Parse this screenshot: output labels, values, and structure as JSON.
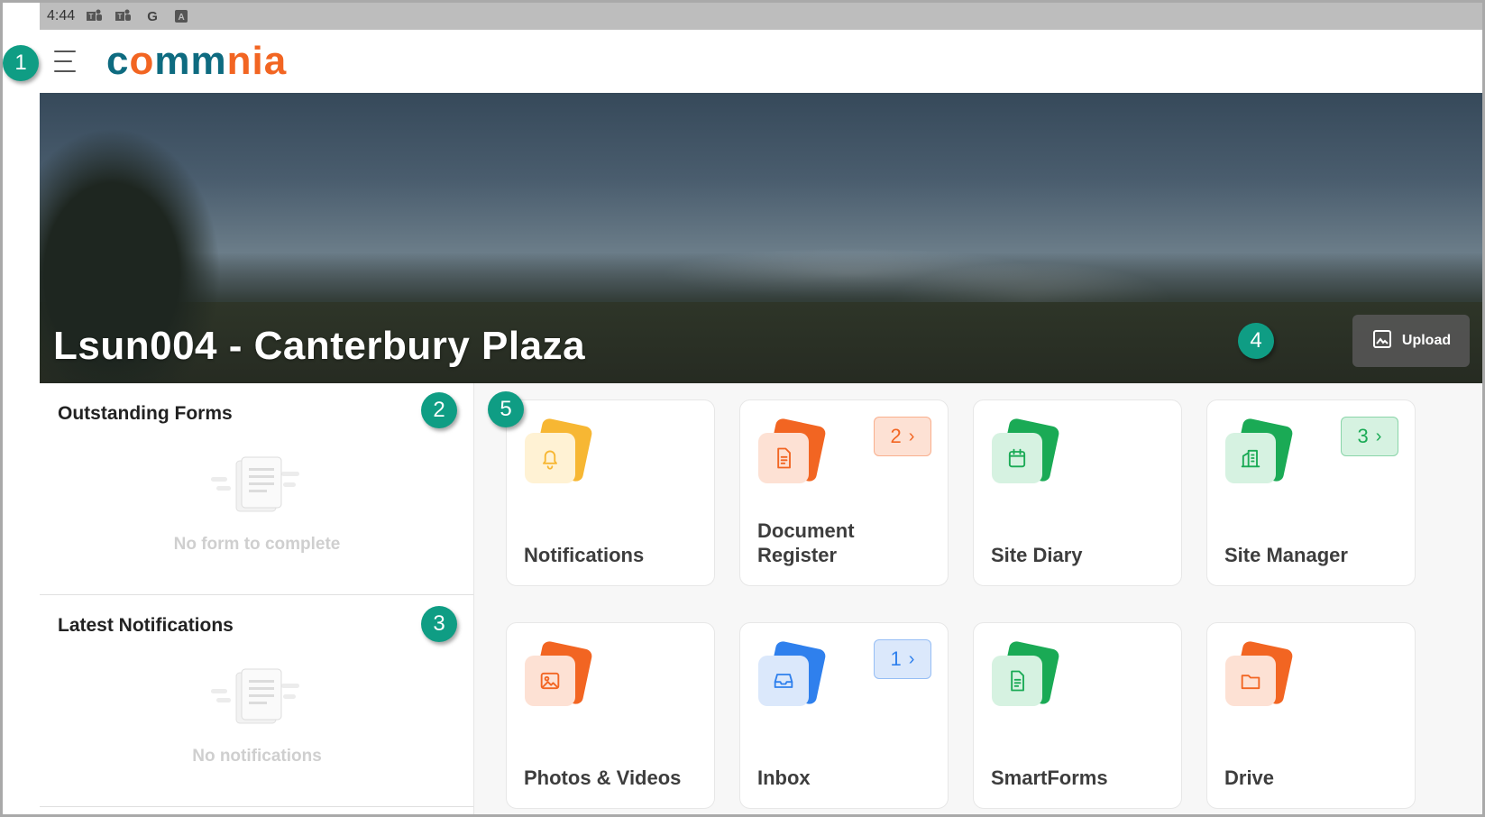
{
  "status_bar": {
    "time": "4:44",
    "icons": [
      "teams-icon",
      "teams-icon",
      "google-icon",
      "a-box-icon"
    ]
  },
  "app": {
    "logo_text": "commnia",
    "menu_icon": "hamburger-icon"
  },
  "callouts": [
    "1",
    "2",
    "3",
    "4",
    "5"
  ],
  "hero": {
    "title": "Lsun004 - Canterbury Plaza",
    "upload_label": "Upload"
  },
  "left_panel": {
    "outstanding_forms": {
      "title": "Outstanding Forms",
      "empty_text": "No form to complete"
    },
    "latest_notifications": {
      "title": "Latest Notifications",
      "empty_text": "No notifications"
    }
  },
  "tiles": [
    {
      "label": "Notifications",
      "icon": "bell-icon",
      "color": "#f7b733",
      "badge": null
    },
    {
      "label": "Document Register",
      "icon": "document-icon",
      "color": "#f26522",
      "badge": "2"
    },
    {
      "label": "Site Diary",
      "icon": "calendar-icon",
      "color": "#1aaa55",
      "badge": null
    },
    {
      "label": "Site Manager",
      "icon": "building-icon",
      "color": "#1aaa55",
      "badge": "3"
    },
    {
      "label": "Photos & Videos",
      "icon": "image-icon",
      "color": "#f26522",
      "badge": null
    },
    {
      "label": "Inbox",
      "icon": "inbox-icon",
      "color": "#2f80ed",
      "badge": "1"
    },
    {
      "label": "SmartForms",
      "icon": "form-icon",
      "color": "#1aaa55",
      "badge": null
    },
    {
      "label": "Drive",
      "icon": "folder-icon",
      "color": "#f26522",
      "badge": null
    }
  ]
}
